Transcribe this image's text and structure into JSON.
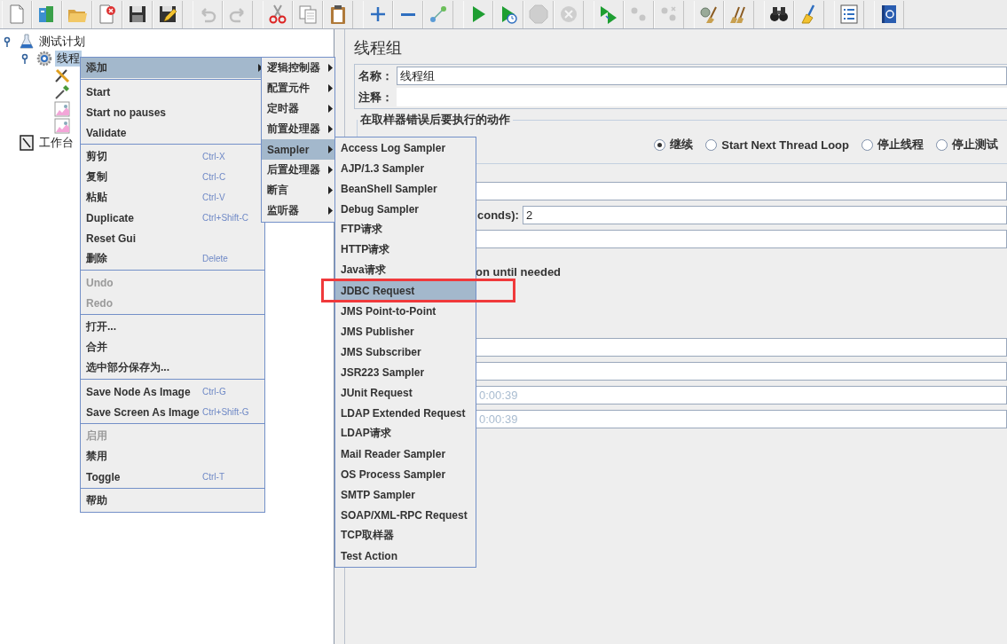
{
  "toolbar": [
    [
      {
        "kind": "new",
        "disabled": false
      },
      {
        "kind": "templates",
        "disabled": false
      },
      {
        "kind": "open",
        "disabled": false
      },
      {
        "kind": "close",
        "disabled": false
      },
      {
        "kind": "save",
        "disabled": false
      },
      {
        "kind": "save-as",
        "disabled": false
      }
    ],
    [
      {
        "kind": "undo",
        "disabled": true
      },
      {
        "kind": "redo",
        "disabled": true
      }
    ],
    [
      {
        "kind": "cut",
        "disabled": false
      },
      {
        "kind": "copy",
        "disabled": false
      },
      {
        "kind": "paste",
        "disabled": false
      }
    ],
    [
      {
        "kind": "expand",
        "disabled": false
      },
      {
        "kind": "collapse",
        "disabled": false
      },
      {
        "kind": "toggle",
        "disabled": false
      }
    ],
    [
      {
        "kind": "start",
        "disabled": false
      },
      {
        "kind": "start-no-pauses",
        "disabled": false
      },
      {
        "kind": "stop",
        "disabled": true
      },
      {
        "kind": "shutdown",
        "disabled": true
      }
    ],
    [
      {
        "kind": "remote-start",
        "disabled": false
      },
      {
        "kind": "remote-stop",
        "disabled": true
      },
      {
        "kind": "remote-exit",
        "disabled": true
      }
    ],
    [
      {
        "kind": "clear",
        "disabled": false
      },
      {
        "kind": "clear-all",
        "disabled": false
      }
    ],
    [
      {
        "kind": "search",
        "disabled": false
      },
      {
        "kind": "reset-search",
        "disabled": false
      }
    ],
    [
      {
        "kind": "function-helper",
        "disabled": false
      }
    ],
    [
      {
        "kind": "help",
        "disabled": false
      }
    ]
  ],
  "tree": [
    {
      "label": "测试计划",
      "kind": "plan",
      "selected": false,
      "expanded": true,
      "children": [
        {
          "label": "线程",
          "kind": "thread-group",
          "selected": true,
          "expanded": true,
          "children": [
            {
              "kind": "config"
            },
            {
              "kind": "sampler"
            },
            {
              "kind": "listener"
            },
            {
              "kind": "listener"
            }
          ]
        }
      ]
    },
    {
      "label": "工作台",
      "kind": "workbench",
      "selected": false
    }
  ],
  "panel": {
    "title": "线程组",
    "name_field": {
      "label": "名称：",
      "value": "线程组"
    },
    "comment_field": {
      "label": "注释："
    },
    "error_action": {
      "title": "在取样器错误后要执行的动作",
      "options": [
        {
          "label": "继续",
          "selected": true
        },
        {
          "label": "Start Next Thread Loop",
          "selected": false
        },
        {
          "label": "停止线程",
          "selected": false
        },
        {
          "label": "停止测试",
          "selected": false
        }
      ]
    },
    "fields_upper": [
      {
        "kind": "field"
      },
      {
        "kind": "field",
        "label": "conds):",
        "value": "2",
        "disabled": false
      },
      {
        "kind": "field"
      },
      {
        "kind": "text",
        "text": "on until needed"
      }
    ],
    "fields_lower": [
      {
        "kind": "field"
      },
      {
        "kind": "field"
      },
      {
        "kind": "field",
        "value": "0:00:39",
        "disabled": true
      },
      {
        "kind": "field",
        "value": "0:00:39",
        "disabled": true
      }
    ]
  },
  "context_menu": {
    "groups": [
      [
        {
          "label": "添加",
          "selected": true,
          "disabled": false,
          "submenu": true
        }
      ],
      [
        {
          "label": "Start",
          "selected": false,
          "disabled": false,
          "submenu": false
        },
        {
          "label": "Start no pauses",
          "selected": false,
          "disabled": false,
          "submenu": false
        },
        {
          "label": "Validate",
          "selected": false,
          "disabled": false,
          "submenu": false
        }
      ],
      [
        {
          "label": "剪切",
          "shortcut": "Ctrl-X",
          "selected": false,
          "disabled": false,
          "submenu": false
        },
        {
          "label": "复制",
          "shortcut": "Ctrl-C",
          "selected": false,
          "disabled": false,
          "submenu": false
        },
        {
          "label": "粘贴",
          "shortcut": "Ctrl-V",
          "selected": false,
          "disabled": false,
          "submenu": false
        },
        {
          "label": "Duplicate",
          "shortcut": "Ctrl+Shift-C",
          "selected": false,
          "disabled": false,
          "submenu": false
        },
        {
          "label": "Reset Gui",
          "selected": false,
          "disabled": false,
          "submenu": false
        },
        {
          "label": "删除",
          "shortcut": "Delete",
          "selected": false,
          "disabled": false,
          "submenu": false
        }
      ],
      [
        {
          "label": "Undo",
          "selected": false,
          "disabled": true,
          "submenu": false
        },
        {
          "label": "Redo",
          "selected": false,
          "disabled": true,
          "submenu": false
        }
      ],
      [
        {
          "label": "打开...",
          "selected": false,
          "disabled": false,
          "submenu": false
        },
        {
          "label": "合并",
          "selected": false,
          "disabled": false,
          "submenu": false
        },
        {
          "label": "选中部分保存为...",
          "selected": false,
          "disabled": false,
          "submenu": false
        }
      ],
      [
        {
          "label": "Save Node As Image",
          "shortcut": "Ctrl-G",
          "selected": false,
          "disabled": false,
          "submenu": false
        },
        {
          "label": "Save Screen As Image",
          "shortcut": "Ctrl+Shift-G",
          "selected": false,
          "disabled": false,
          "submenu": false
        }
      ],
      [
        {
          "label": "启用",
          "selected": false,
          "disabled": true,
          "submenu": false
        },
        {
          "label": "禁用",
          "selected": false,
          "disabled": false,
          "submenu": false
        },
        {
          "label": "Toggle",
          "shortcut": "Ctrl-T",
          "selected": false,
          "disabled": false,
          "submenu": false
        }
      ],
      [
        {
          "label": "帮助",
          "selected": false,
          "disabled": false,
          "submenu": false
        }
      ]
    ]
  },
  "category_menu": {
    "items": [
      {
        "label": "逻辑控制器",
        "selected": false,
        "submenu": true
      },
      {
        "label": "配置元件",
        "selected": false,
        "submenu": true
      },
      {
        "label": "定时器",
        "selected": false,
        "submenu": true
      },
      {
        "label": "前置处理器",
        "selected": false,
        "submenu": true
      },
      {
        "label": "Sampler",
        "selected": true,
        "submenu": true
      },
      {
        "label": "后置处理器",
        "selected": false,
        "submenu": true
      },
      {
        "label": "断言",
        "selected": false,
        "submenu": true
      },
      {
        "label": "监听器",
        "selected": false,
        "submenu": true
      }
    ]
  },
  "sampler_menu": {
    "items": [
      {
        "label": "Access Log Sampler",
        "selected": false
      },
      {
        "label": "AJP/1.3 Sampler",
        "selected": false
      },
      {
        "label": "BeanShell Sampler",
        "selected": false
      },
      {
        "label": "Debug Sampler",
        "selected": false
      },
      {
        "label": "FTP请求",
        "selected": false
      },
      {
        "label": "HTTP请求",
        "selected": false
      },
      {
        "label": "Java请求",
        "selected": false
      },
      {
        "label": "JDBC Request",
        "selected": true
      },
      {
        "label": "JMS Point-to-Point",
        "selected": false
      },
      {
        "label": "JMS Publisher",
        "selected": false
      },
      {
        "label": "JMS Subscriber",
        "selected": false
      },
      {
        "label": "JSR223 Sampler",
        "selected": false
      },
      {
        "label": "JUnit Request",
        "selected": false
      },
      {
        "label": "LDAP Extended Request",
        "selected": false
      },
      {
        "label": "LDAP请求",
        "selected": false
      },
      {
        "label": "Mail Reader Sampler",
        "selected": false
      },
      {
        "label": "OS Process Sampler",
        "selected": false
      },
      {
        "label": "SMTP Sampler",
        "selected": false
      },
      {
        "label": "SOAP/XML-RPC Request",
        "selected": false
      },
      {
        "label": "TCP取样器",
        "selected": false
      },
      {
        "label": "Test Action",
        "selected": false
      }
    ]
  }
}
